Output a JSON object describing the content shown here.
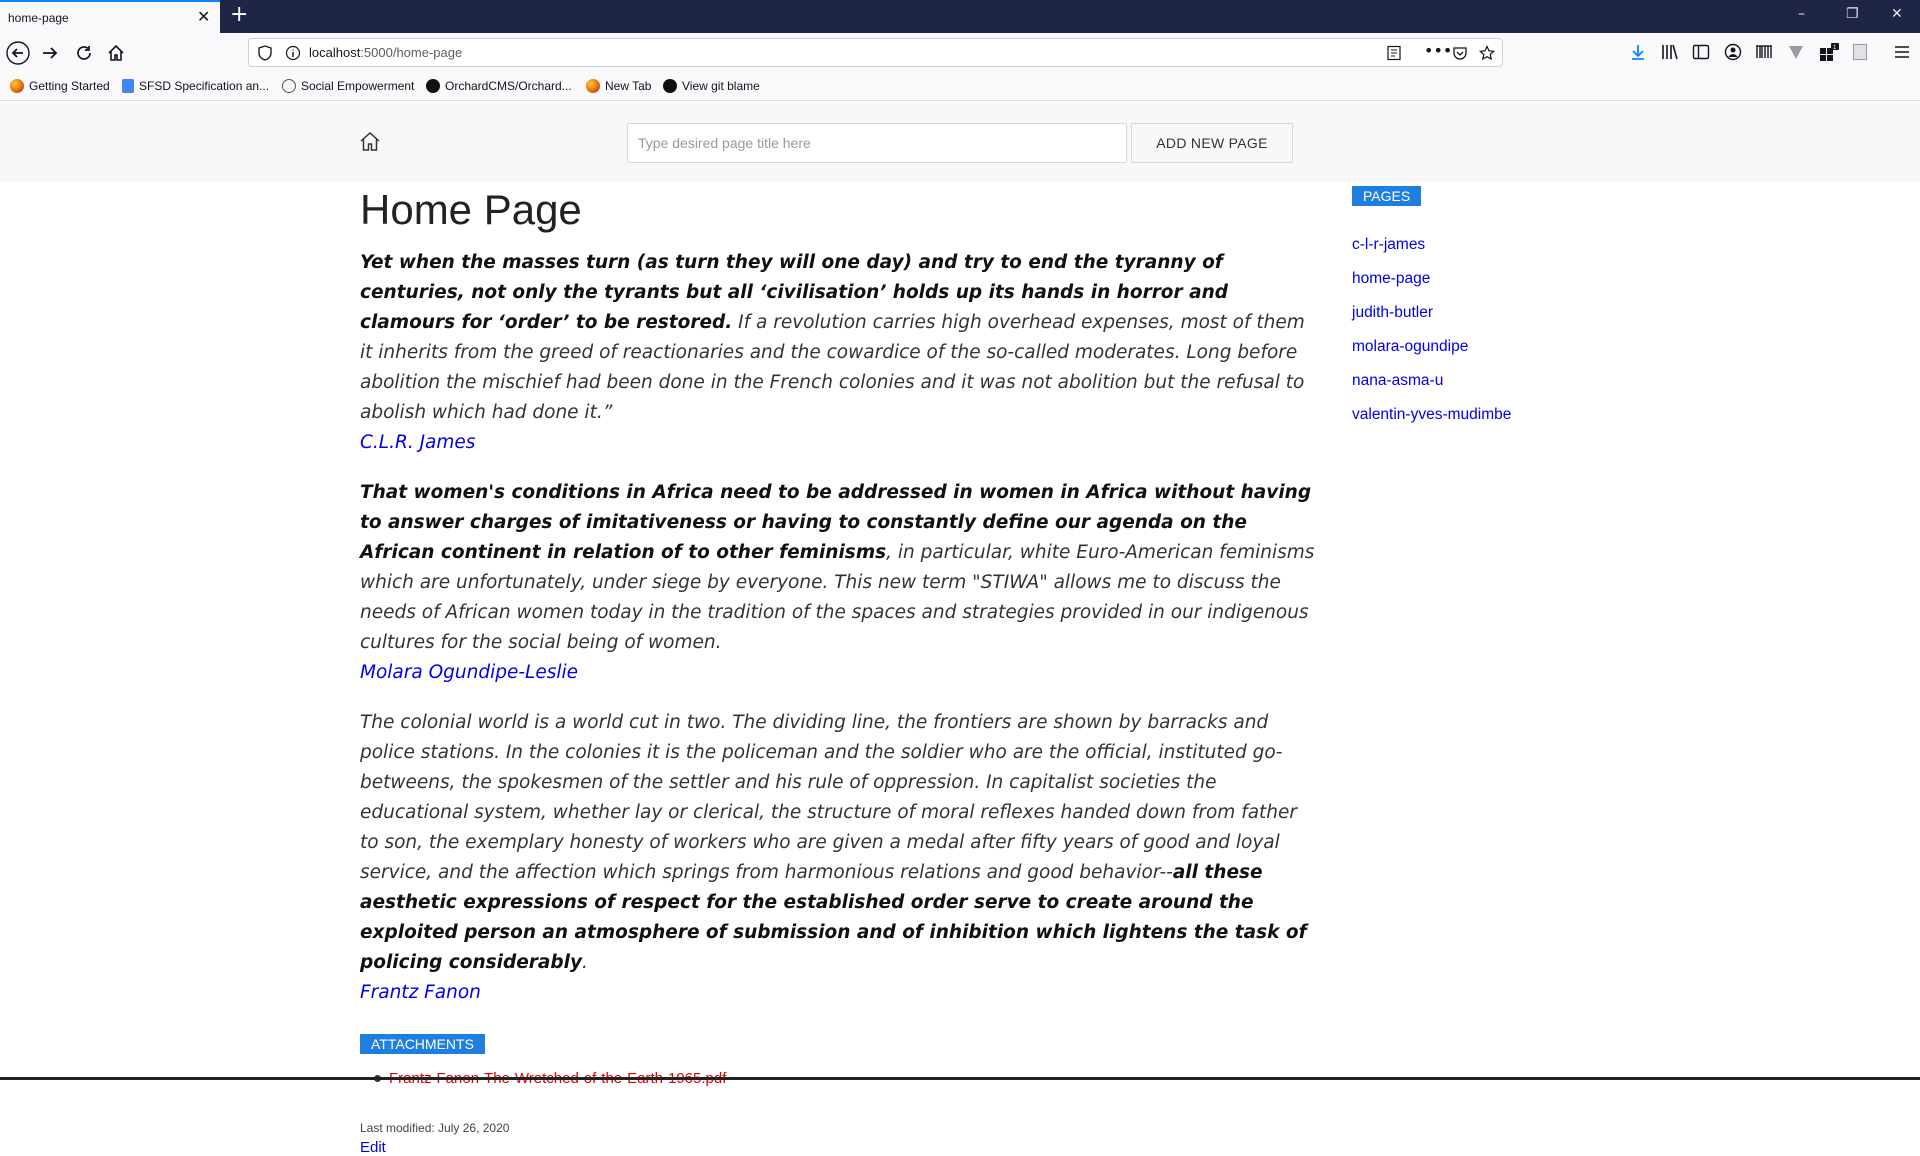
{
  "browser": {
    "tab_title": "home-page",
    "url_host": "localhost",
    "url_path": ":5000/home-page",
    "bookmarks": [
      {
        "label": "Getting Started",
        "icon": "firefox-icon",
        "color": "#e66000"
      },
      {
        "label": "SFSD Specification an...",
        "icon": "docs-icon",
        "color": "#4285f4"
      },
      {
        "label": "Social Empowerment",
        "icon": "globe-icon",
        "color": "#555555"
      },
      {
        "label": "OrchardCMS/Orchard...",
        "icon": "github-icon",
        "color": "#111111"
      },
      {
        "label": "New Tab",
        "icon": "firefox-icon",
        "color": "#e66000"
      },
      {
        "label": "View git blame",
        "icon": "github-icon",
        "color": "#111111"
      }
    ]
  },
  "header": {
    "input_placeholder": "Type desired page title here",
    "add_button_label": "ADD NEW PAGE"
  },
  "main": {
    "title": "Home Page",
    "quotes": [
      {
        "bold": "Yet when the masses turn (as turn they will one day) and try to end the tyranny of centuries, not only the tyrants but all ‘civilisation’ holds up its hands in horror and clamours for ‘order’ to be restored.",
        "rest": " If a revolution carries high overhead expenses, most of them it inherits from the greed of reactionaries and the cowardice of the so-called moderates. Long before abolition the mischief had been done in the French colonies and it was not abolition but the refusal to abolish which had done it.”",
        "author": "C.L.R. James"
      },
      {
        "bold": "That women's conditions in Africa need to be addressed in women in Africa without having to answer charges of imitativeness or having to constantly define our agenda on the African continent in relation of to other feminisms",
        "rest": ", in particular, white Euro-American feminisms which are unfortunately, under siege by everyone. This new term \"STIWA\" allows me to discuss the needs of African women today in the tradition of the spaces and strategies provided in our indigenous cultures for the social being of women.",
        "author": "Molara Ogundipe-Leslie"
      },
      {
        "plain": "The colonial world is a world cut in two. The dividing line, the frontiers are shown by barracks and police stations. In the colonies it is the policeman and the soldier who are the official, instituted go-betweens, the spokesmen of the settler and his rule of oppression. In capitalist societies the educational system, whether lay or clerical, the structure of moral reflexes handed down from father to son, the exemplary honesty of workers who are given a medal after fifty years of good and loyal service, and the affection which springs from harmonious relations and good behavior--",
        "bold": "all these aesthetic expressions of respect for the established order serve to create around the exploited person an atmosphere of submission and of inhibition which lightens the task of policing considerably",
        "end": ".",
        "author": "Frantz Fanon"
      }
    ],
    "attachments_label": "ATTACHMENTS",
    "attachments": [
      "Frantz-Fanon-The-Wretched-of-the-Earth-1965.pdf"
    ],
    "last_modified": "Last modified: July 26, 2020",
    "edit_label": "Edit"
  },
  "sidebar": {
    "label": "PAGES",
    "pages": [
      "c-l-r-james",
      "home-page",
      "judith-butler",
      "molara-ogundipe",
      "nana-asma-u",
      "valentin-yves-mudimbe"
    ]
  },
  "colors": {
    "badge": "#1e7fe0",
    "link": "#0000ee",
    "attachment_link": "#e00000",
    "titlebar": "#1f2544"
  }
}
